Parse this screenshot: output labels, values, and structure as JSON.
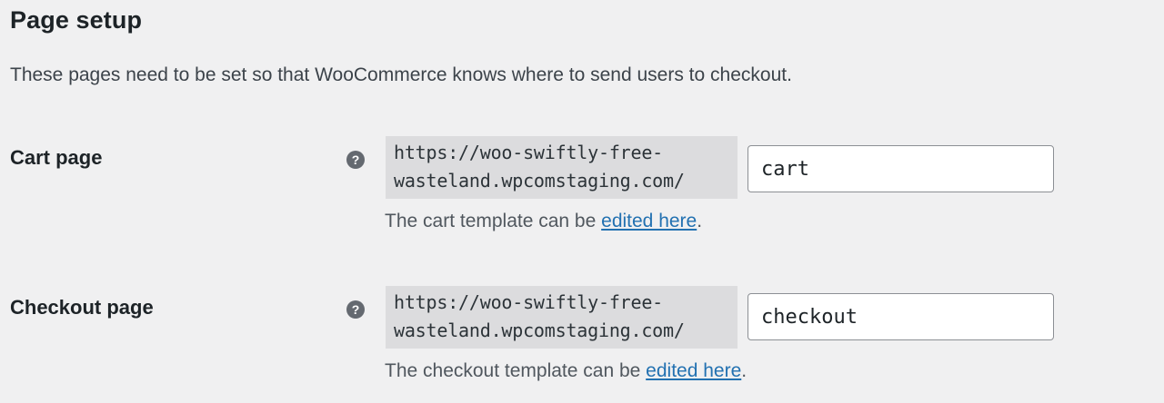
{
  "page": {
    "title": "Page setup",
    "description": "These pages need to be set so that WooCommerce knows where to send users to checkout."
  },
  "rows": [
    {
      "label": "Cart page",
      "help_icon": "question-mark-icon",
      "url_prefix": "https://woo-swiftly-free-\nwasteland.wpcomstaging.com/",
      "slug_value": "cart",
      "help_text_before": "The cart template can be ",
      "help_link": "edited here",
      "help_text_after": "."
    },
    {
      "label": "Checkout page",
      "help_icon": "question-mark-icon",
      "url_prefix": "https://woo-swiftly-free-\nwasteland.wpcomstaging.com/",
      "slug_value": "checkout",
      "help_text_before": "The checkout template can be ",
      "help_link": "edited here",
      "help_text_after": "."
    }
  ]
}
